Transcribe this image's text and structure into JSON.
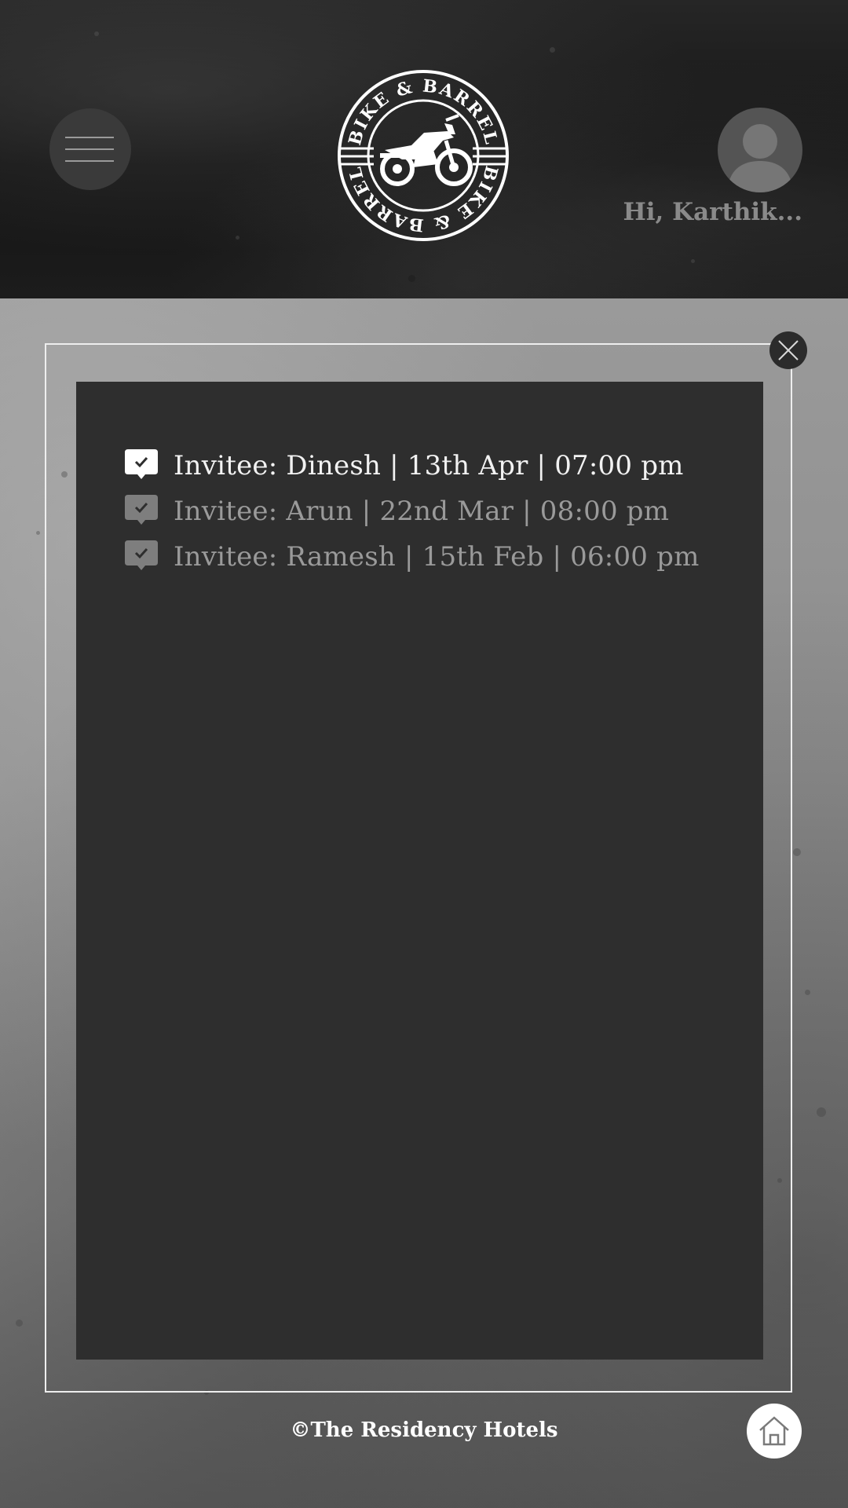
{
  "header": {
    "logo_text_top": "BIKE & BARREL",
    "logo_text_bottom": "BIKE & BARREL",
    "greeting": "Hi, Karthik...",
    "menu_icon": "hamburger-menu-icon",
    "avatar_icon": "user-avatar-icon"
  },
  "invitations": [
    {
      "text": "Invitee: Dinesh | 13th Apr | 07:00 pm",
      "state": "active"
    },
    {
      "text": "Invitee: Arun | 22nd Mar | 08:00 pm",
      "state": "inactive"
    },
    {
      "text": "Invitee: Ramesh | 15th Feb | 06:00 pm",
      "state": "inactive"
    }
  ],
  "footer": {
    "copyright": "©The Residency Hotels",
    "home_icon": "home-icon"
  },
  "colors": {
    "header_bg": "#1a1a1a",
    "panel_bg": "#2e2e2e",
    "active_text": "#f2f2f2",
    "inactive_text": "#9a9a9a",
    "frame_border": "#eeeeee"
  }
}
